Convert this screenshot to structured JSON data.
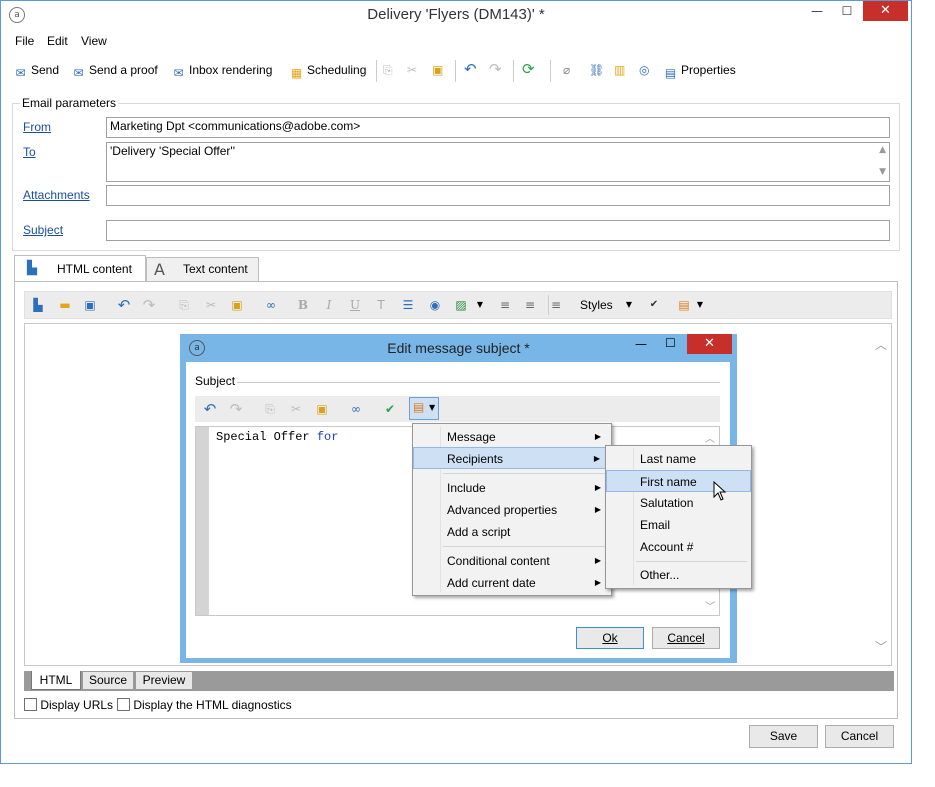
{
  "window": {
    "title": "Delivery 'Flyers (DM143)' *",
    "minimize": "—",
    "maximize": "☐",
    "close": "✕"
  },
  "menubar": [
    "File",
    "Edit",
    "View"
  ],
  "toolbar": {
    "send": "Send",
    "send_proof": "Send a proof",
    "inbox": "Inbox rendering",
    "scheduling": "Scheduling",
    "properties": "Properties"
  },
  "email_params": {
    "legend": "Email parameters",
    "from_label": "From",
    "from_value": "Marketing Dpt <communications@adobe.com>",
    "to_label": "To",
    "to_value": "'Delivery 'Special Offer''",
    "attachments_label": "Attachments",
    "attachments_value": "",
    "subject_label": "Subject",
    "subject_value": ""
  },
  "content_tabs": {
    "html": "HTML content",
    "text": "Text content"
  },
  "editor_toolbar": {
    "styles": "Styles",
    "bold": "B",
    "italic": "I",
    "underline": "U"
  },
  "bottom_tabs": [
    "HTML",
    "Source",
    "Preview"
  ],
  "checkboxes": {
    "display_urls": "Display URLs",
    "display_html_diag": "Display the HTML diagnostics"
  },
  "buttons": {
    "save": "Save",
    "cancel": "Cancel"
  },
  "dialog": {
    "title": "Edit message subject *",
    "group": "Subject",
    "text_plain": "Special Offer ",
    "text_keyword": "for",
    "ok": "Ok",
    "cancel": "Cancel"
  },
  "context_menu": [
    "Message",
    "Recipients",
    "Include",
    "Advanced properties",
    "Add a script",
    "Conditional content",
    "Add current date"
  ],
  "submenu": [
    "Last name",
    "First name",
    "Salutation",
    "Email",
    "Account #",
    "Other..."
  ],
  "colors": {
    "accent": "#3c8fd6",
    "close": "#c7302a",
    "highlight": "#cde0f4"
  }
}
